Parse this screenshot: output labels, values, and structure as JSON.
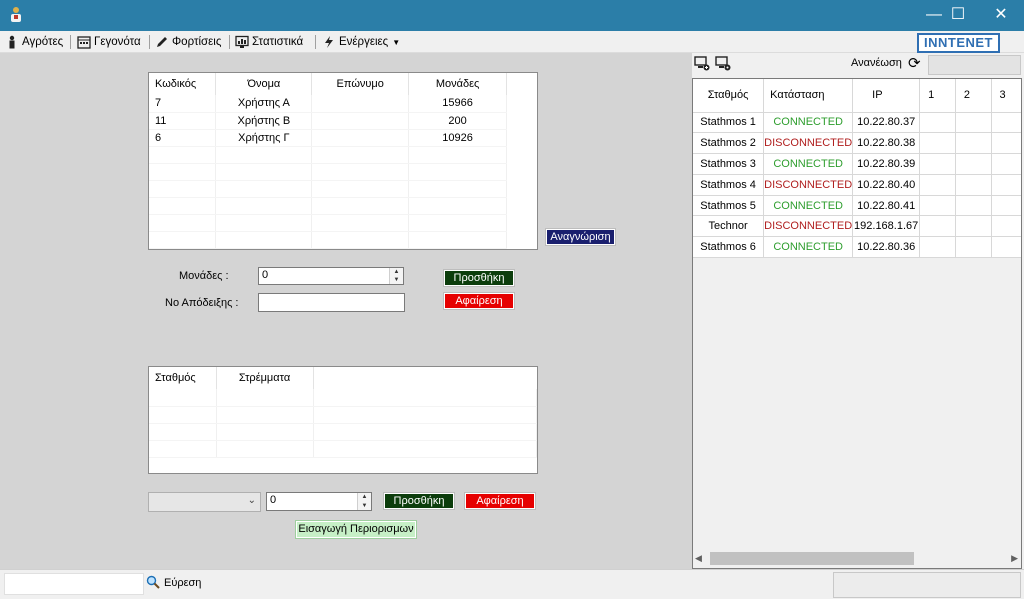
{
  "menu": {
    "farmers": "Αγρότες",
    "events": "Γεγονότα",
    "loads": "Φορτίσεις",
    "statistics": "Στατιστικά",
    "actions": "Ενέργειες"
  },
  "logo": "INNTENET",
  "users_grid": {
    "headers": [
      "Κωδικός",
      "Όνομα",
      "Επώνυμο",
      "Μονάδες"
    ],
    "rows": [
      {
        "code": "7",
        "first": "Χρήστης Α",
        "last": "",
        "units": "15966"
      },
      {
        "code": "11",
        "first": "Χρήστης Β",
        "last": "",
        "units": "200"
      },
      {
        "code": "6",
        "first": "Χρήστης Γ",
        "last": "",
        "units": "10926"
      }
    ]
  },
  "recognition_button": "Αναγνώριση",
  "units_form": {
    "units_label": "Μονάδες  :",
    "units_value": "0",
    "receipt_label": "Νο Απόδειξης  :",
    "receipt_value": "",
    "add_button": "Προσθήκη",
    "remove_button": "Αφαίρεση"
  },
  "stations_grid": {
    "headers": [
      "Σταθμός",
      "Στρέμματα"
    ]
  },
  "restriction_form": {
    "station_value": "",
    "acres_value": "0",
    "add_button": "Προσθήκη",
    "remove_button": "Αφαίρεση",
    "insert_button": "Εισαγωγή Περιορισμων"
  },
  "right_panel": {
    "refresh_label": "Ανανέωση",
    "headers": [
      "Σταθμός",
      "Κατάσταση",
      "IP",
      "1",
      "2",
      "3"
    ],
    "rows": [
      {
        "station": "Stathmos 1",
        "status": "CONNECTED",
        "ip": "10.22.80.37",
        "state": "connected"
      },
      {
        "station": "Stathmos 2",
        "status": "DISCONNECTED",
        "ip": "10.22.80.38",
        "state": "disconnected"
      },
      {
        "station": "Stathmos 3",
        "status": "CONNECTED",
        "ip": "10.22.80.39",
        "state": "connected"
      },
      {
        "station": "Stathmos 4",
        "status": "DISCONNECTED",
        "ip": "10.22.80.40",
        "state": "disconnected"
      },
      {
        "station": "Stathmos 5",
        "status": "CONNECTED",
        "ip": "10.22.80.41",
        "state": "connected"
      },
      {
        "station": "Technor",
        "status": "DISCONNECTED",
        "ip": "192.168.1.67",
        "state": "disconnected"
      },
      {
        "station": "Stathmos 6",
        "status": "CONNECTED",
        "ip": "10.22.80.36",
        "state": "connected"
      }
    ]
  },
  "statusbar": {
    "search_value": "",
    "search_label": "Εύρεση"
  },
  "colors": {
    "titlebar": "#2b7ea8",
    "connected": "#2e9e2e",
    "disconnected": "#b01e1e",
    "add_button": "#0c3d0c",
    "remove_button": "#e60000",
    "recognition_button": "#1a1f6e"
  }
}
